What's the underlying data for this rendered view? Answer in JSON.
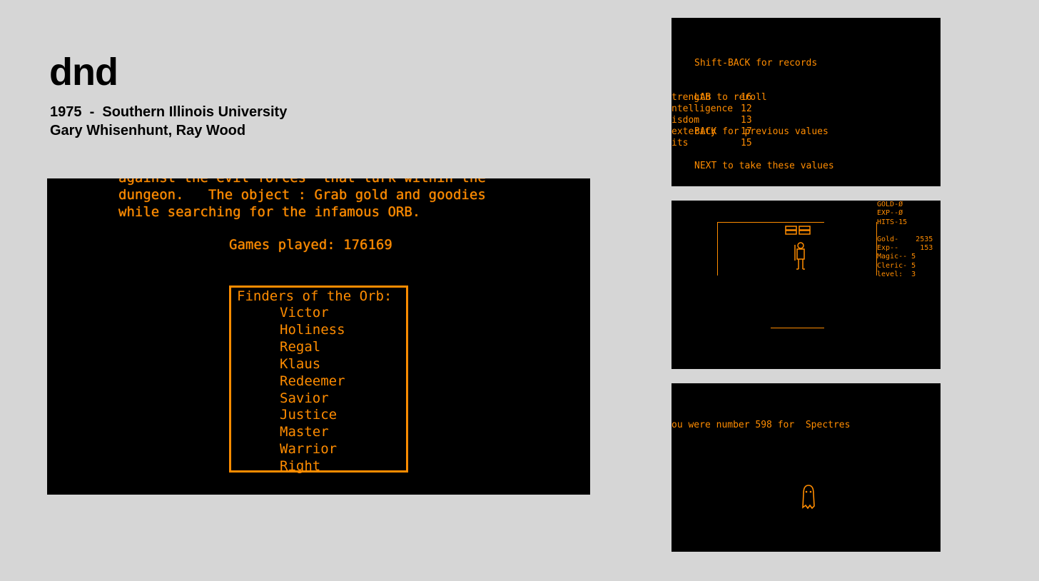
{
  "header": {
    "title": "dnd",
    "year_line": "1975  -  Southern Illinois University",
    "authors": "Gary Whisenhunt, Ray Wood"
  },
  "main_screen": {
    "lines": [
      "against the evil forces  that lurk within the",
      "dungeon.   The object : Grab gold and goodies",
      "while searching for the infamous ORB."
    ],
    "games_played": "Games played: 176169",
    "finders_title": "Finders of the Orb:",
    "finders": [
      "Victor",
      "Holiness",
      "Regal",
      "Klaus",
      "Redeemer",
      "Savior",
      "Justice",
      "Master",
      "Warrior",
      "Right"
    ]
  },
  "screen_stats": {
    "instructions": [
      "Shift-BACK for records",
      "LAB to reroll",
      "BACK for previous values",
      "NEXT to take these values"
    ],
    "stats": [
      {
        "name": "trength",
        "value": "16"
      },
      {
        "name": "ntelligence",
        "value": "12"
      },
      {
        "name": "isdom",
        "value": "13"
      },
      {
        "name": "exterity",
        "value": "17"
      },
      {
        "name": "its",
        "value": "15"
      }
    ]
  },
  "screen_dungeon": {
    "top_status": [
      "GOLD-Ø",
      "EXP--Ø",
      "HITS-15"
    ],
    "stats": [
      "Gold-    2535",
      "Exp--     153",
      "Magic-- 5",
      "Cleric- 5",
      "level:  3"
    ]
  },
  "screen_death": {
    "message": "ou were number 598 for  Spectres"
  },
  "colors": {
    "background": "#d6d6d6",
    "screen": "#000000",
    "plato_orange": "#ff8c00"
  }
}
